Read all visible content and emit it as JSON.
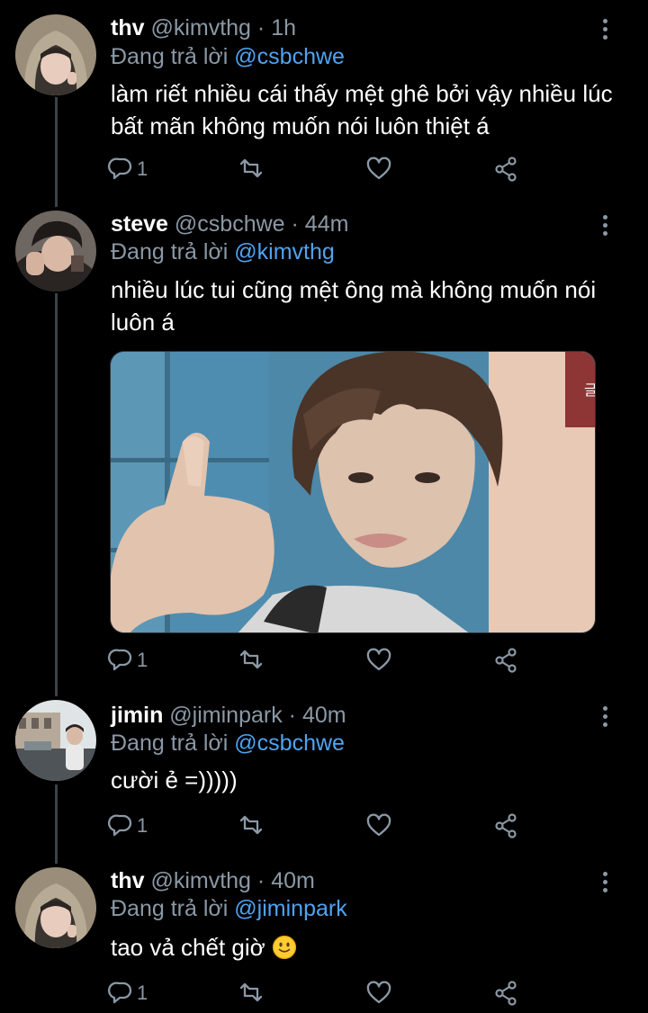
{
  "reply_prefix": "Đang trả lời",
  "tweets": [
    {
      "name": "thv",
      "handle": "@kimvthg",
      "sep": "·",
      "time": "1h",
      "reply_to": "@csbchwe",
      "text": "làm riết nhiều cái thấy mệt ghê bởi vậy nhiều lúc bất mãn không muốn nói luôn thiệt á",
      "reply_count": "1"
    },
    {
      "name": "steve",
      "handle": "@csbchwe",
      "sep": "·",
      "time": "44m",
      "reply_to": "@kimvthg",
      "text": "nhiều lúc tui cũng mệt ông mà không muốn nói luôn á",
      "reply_count": "1",
      "media_sign": "글"
    },
    {
      "name": "jimin",
      "handle": "@jiminpark",
      "sep": "·",
      "time": "40m",
      "reply_to": "@csbchwe",
      "text": "cười ẻ =)))))",
      "reply_count": "1"
    },
    {
      "name": "thv",
      "handle": "@kimvthg",
      "sep": "·",
      "time": "40m",
      "reply_to": "@jiminpark",
      "text": "tao vả chết giờ",
      "emoji": "slightly-smiling-face",
      "reply_count": "1"
    }
  ],
  "colors": {
    "background": "#000000",
    "name": "#ffffff",
    "meta": "#8b98a5",
    "mention": "#4fa3f0",
    "thread_line": "#3d4248"
  },
  "icons": [
    "reply-icon",
    "retweet-icon",
    "like-icon",
    "share-icon",
    "more-options-icon"
  ]
}
